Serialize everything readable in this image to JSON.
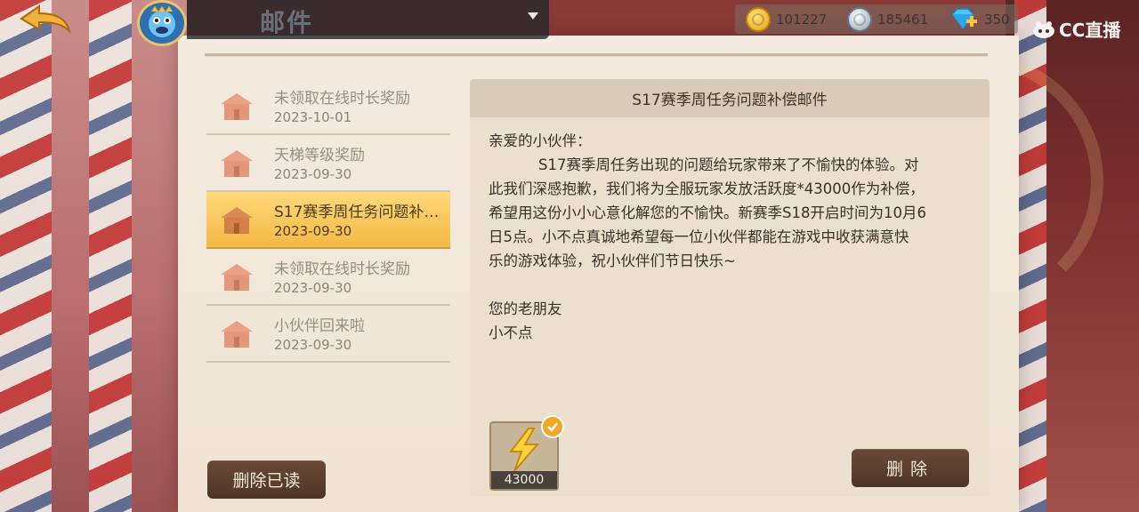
{
  "header": {
    "title": "邮件"
  },
  "currency": {
    "gold": "101227",
    "silver": "185461",
    "diamond": "350"
  },
  "watermark": "CC直播",
  "mail_list": [
    {
      "title": "未领取在线时长奖励",
      "date": "2023-10-01",
      "selected": false
    },
    {
      "title": "天梯等级奖励",
      "date": "2023-09-30",
      "selected": false
    },
    {
      "title": "S17赛季周任务问题补…",
      "date": "2023-09-30",
      "selected": true
    },
    {
      "title": "未领取在线时长奖励",
      "date": "2023-09-30",
      "selected": false
    },
    {
      "title": "小伙伴回来啦",
      "date": "2023-09-30",
      "selected": false
    }
  ],
  "buttons": {
    "delete_read": "删除已读",
    "delete": "删除"
  },
  "mail_detail": {
    "subject": "S17赛季周任务问题补偿邮件",
    "greeting": "亲爱的小伙伴：",
    "lines": [
      "S17赛季周任务出现的问题给玩家带来了不愉快的体验。对",
      "此我们深感抱歉，我们将为全服玩家发放活跃度*43000作为补偿，",
      "希望用这份小小心意化解您的不愉快。新赛季S18开启时间为10月6",
      "日5点。小不点真诚地希望每一位小伙伴都能在游戏中收获满意快",
      "乐的游戏体验，祝小伙伴们节日快乐~"
    ],
    "sign_line1": "您的老朋友",
    "sign_line2": "小不点"
  },
  "attachment": {
    "icon": "lightning-icon",
    "count": "43000",
    "claimed": true
  }
}
